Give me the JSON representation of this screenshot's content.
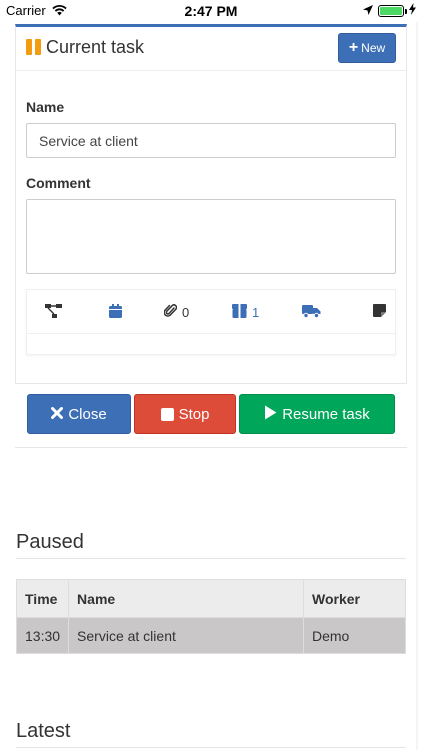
{
  "status_bar": {
    "carrier": "Carrier",
    "time": "2:47 PM"
  },
  "current_task": {
    "title": "Current task",
    "new_button": "New",
    "name_label": "Name",
    "name_value": "Service at client",
    "comment_label": "Comment",
    "comment_value": "",
    "tools": [
      {
        "icon": "hierarchy-icon",
        "count": ""
      },
      {
        "icon": "calendar-icon",
        "count": ""
      },
      {
        "icon": "paperclip-icon",
        "count": "0"
      },
      {
        "icon": "box-icon",
        "count": "1"
      },
      {
        "icon": "truck-icon",
        "count": ""
      },
      {
        "icon": "note-icon",
        "count": ""
      }
    ]
  },
  "actions": {
    "close": "Close",
    "stop": "Stop",
    "resume": "Resume task"
  },
  "paused": {
    "title": "Paused",
    "columns": [
      "Time",
      "Name",
      "Worker"
    ],
    "rows": [
      {
        "time": "13:30",
        "name": "Service at client",
        "worker": "Demo"
      }
    ]
  },
  "latest": {
    "title": "Latest"
  },
  "colors": {
    "primary": "#3d6fb6",
    "danger": "#dd4b39",
    "success": "#00a65a",
    "warning": "#f39c12"
  }
}
